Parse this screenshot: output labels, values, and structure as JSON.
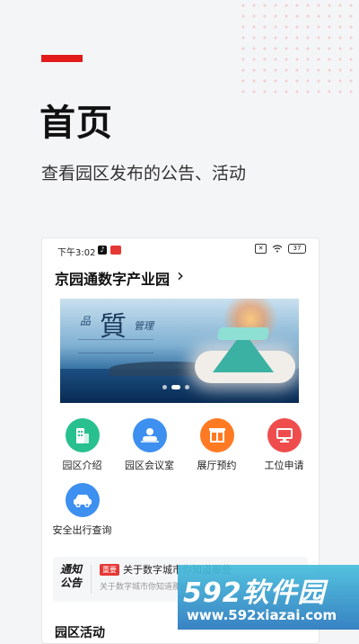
{
  "page": {
    "title": "首页",
    "subtitle": "查看园区发布的公告、活动"
  },
  "phone": {
    "status_time": "下午3:02",
    "battery": "37",
    "x_label": "✕",
    "tiktok_icon": "♪",
    "park_name": "京园通数字产业园",
    "park_chevron": "›"
  },
  "banner": {
    "char_main": "質",
    "char_small": "品",
    "char_right": "管理",
    "slides_count": 3,
    "active_slide": 2
  },
  "services": [
    {
      "label": "园区介绍",
      "color": "#29c08f",
      "icon": "building-icon"
    },
    {
      "label": "园区会议室",
      "color": "#3d8ff0",
      "icon": "meeting-room-icon"
    },
    {
      "label": "展厅预约",
      "color": "#ff7a22",
      "icon": "hall-icon"
    },
    {
      "label": "工位申请",
      "color": "#ef4d4d",
      "icon": "workstation-icon"
    },
    {
      "label": "安全出行查询",
      "color": "#3d8ff0",
      "icon": "car-icon"
    }
  ],
  "notice": {
    "tag_line1": "通知",
    "tag_line2": "公告",
    "badge": "重要",
    "headline": "关于数字城市你知道那些",
    "sub": "关于数字城市你知道那些"
  },
  "section_activity": "园区活动",
  "watermark": {
    "brand": "592软件园",
    "url": "www.592xiazai.com"
  },
  "colors": {
    "accent": "#e21a1a",
    "background": "#f4f5f7"
  }
}
